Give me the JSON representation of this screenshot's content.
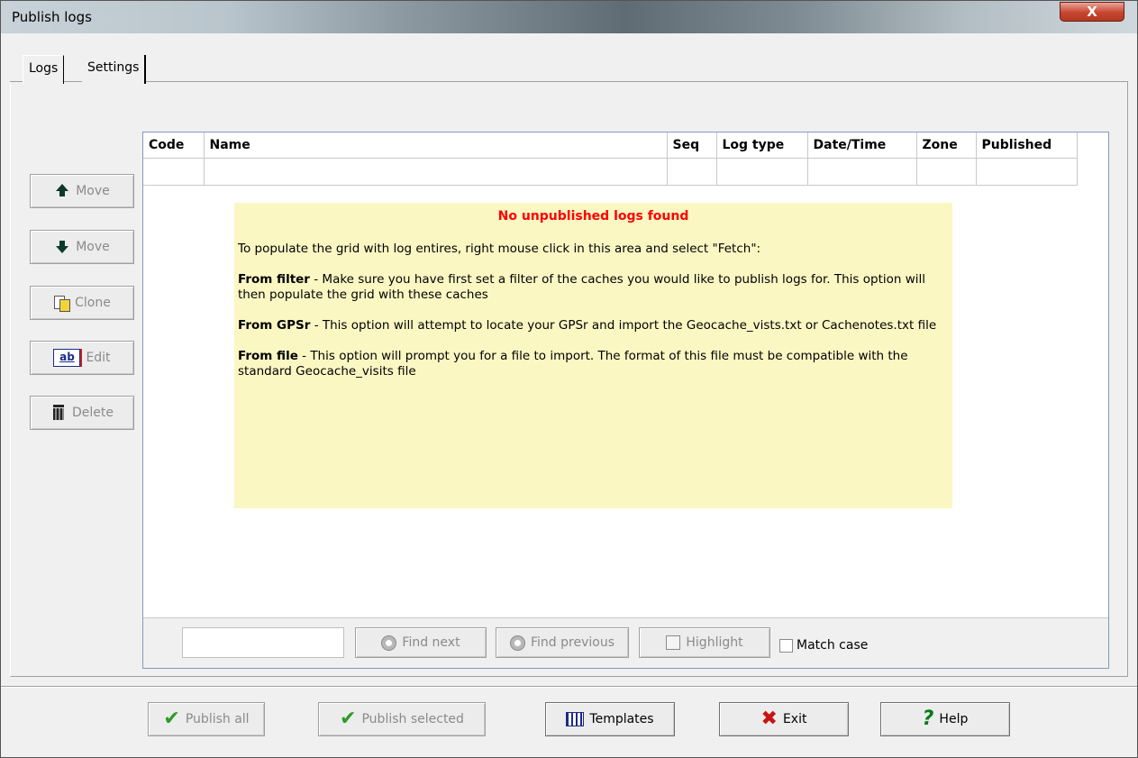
{
  "window": {
    "title": "Publish logs",
    "close_label": "X"
  },
  "tabs": [
    {
      "label": "Logs"
    },
    {
      "label": "Settings"
    }
  ],
  "side_buttons": {
    "move_up": "Move",
    "move_down": "Move",
    "clone": "Clone",
    "edit": "Edit",
    "delete": "Delete",
    "edit_icon_text": "ab"
  },
  "grid": {
    "columns": [
      "Code",
      "Name",
      "Seq",
      "Log type",
      "Date/Time",
      "Zone",
      "Published"
    ]
  },
  "info": {
    "title": "No unpublished logs found",
    "intro": "To populate the grid with log entires, right mouse click in this area and select \"Fetch\":",
    "filter_label": "From filter",
    "filter_text": " - Make sure you have first set a filter of the caches you would like to publish logs for. This option will then populate the grid with these caches",
    "gpsr_label": "From GPSr",
    "gpsr_text": " - This option will attempt to locate your GPSr and import the Geocache_vists.txt or Cachenotes.txt file",
    "file_label": "From file",
    "file_text": " - This option will prompt you for a file to import. The format of this file must be compatible with the standard Geocache_visits file"
  },
  "find": {
    "value": "",
    "find_next": "Find next",
    "find_previous": "Find previous",
    "highlight": "Highlight",
    "match_case": "Match case"
  },
  "bottom_buttons": {
    "publish_all": "Publish all",
    "publish_selected": "Publish selected",
    "templates": "Templates",
    "exit": "Exit",
    "help": "Help"
  }
}
